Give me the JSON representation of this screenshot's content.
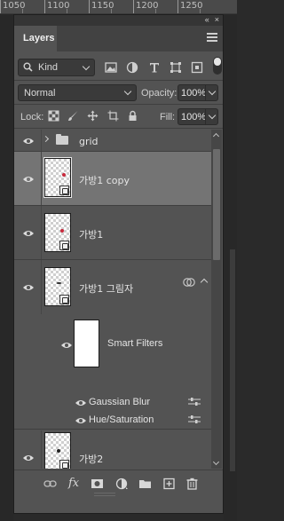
{
  "ruler": {
    "labels": [
      "1050",
      "1100",
      "1150",
      "1200",
      "1250"
    ]
  },
  "panel": {
    "tab_label": "Layers",
    "collapse_label": "«",
    "close_label": "×"
  },
  "filter": {
    "kind_label": "Kind"
  },
  "blend": {
    "mode": "Normal",
    "opacity_label": "Opacity:",
    "opacity_value": "100%"
  },
  "lock": {
    "label": "Lock:",
    "fill_label": "Fill:",
    "fill_value": "100%"
  },
  "layers": [
    {
      "name": "grid",
      "type": "group"
    },
    {
      "name": "가방1 copy",
      "type": "smart",
      "selected": true
    },
    {
      "name": "가방1",
      "type": "smart"
    },
    {
      "name": "가방1 그림자",
      "type": "smart",
      "has_filters": true
    },
    {
      "name": "가방2",
      "type": "smart"
    }
  ],
  "smart_filters": {
    "label": "Smart Filters",
    "items": [
      "Gaussian Blur",
      "Hue/Saturation"
    ]
  },
  "bottom_bar": {
    "fx_label": "fx"
  },
  "colors": {
    "panel_bg": "#535353",
    "selected_row": "#747474",
    "thumb_red": "#c8283c"
  }
}
